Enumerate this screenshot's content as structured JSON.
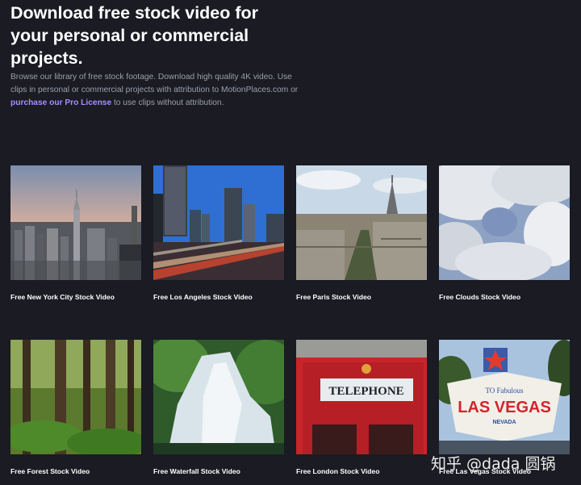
{
  "hero": {
    "headline_lines": [
      "Download free stock video for",
      "your personal or commercial",
      "projects."
    ],
    "intro_line1": "Browse our library of free stock footage. Download high quality 4K video. Use",
    "intro_line2": "clips in personal or commercial projects with attribution to MotionPlaces.com or",
    "intro_link": "purchase our Pro License",
    "intro_line3_rest": " to use clips without attribution."
  },
  "cards": [
    {
      "caption": "Free New York City Stock Video",
      "scene": "new-york"
    },
    {
      "caption": "Free Los Angeles Stock Video",
      "scene": "los-angeles"
    },
    {
      "caption": "Free Paris Stock Video",
      "scene": "paris"
    },
    {
      "caption": "Free Clouds Stock Video",
      "scene": "clouds"
    },
    {
      "caption": "Free Forest Stock Video",
      "scene": "forest"
    },
    {
      "caption": "Free Waterfall Stock Video",
      "scene": "waterfall"
    },
    {
      "caption": "Free London Stock Video",
      "scene": "london"
    },
    {
      "caption": "Free Las Vegas Stock Video",
      "scene": "las-vegas"
    }
  ],
  "watermark": "知乎 @dada 圆锅",
  "colors": {
    "background": "#1a1b23",
    "link": "#a98cff",
    "body_text": "#9aa0ac"
  }
}
